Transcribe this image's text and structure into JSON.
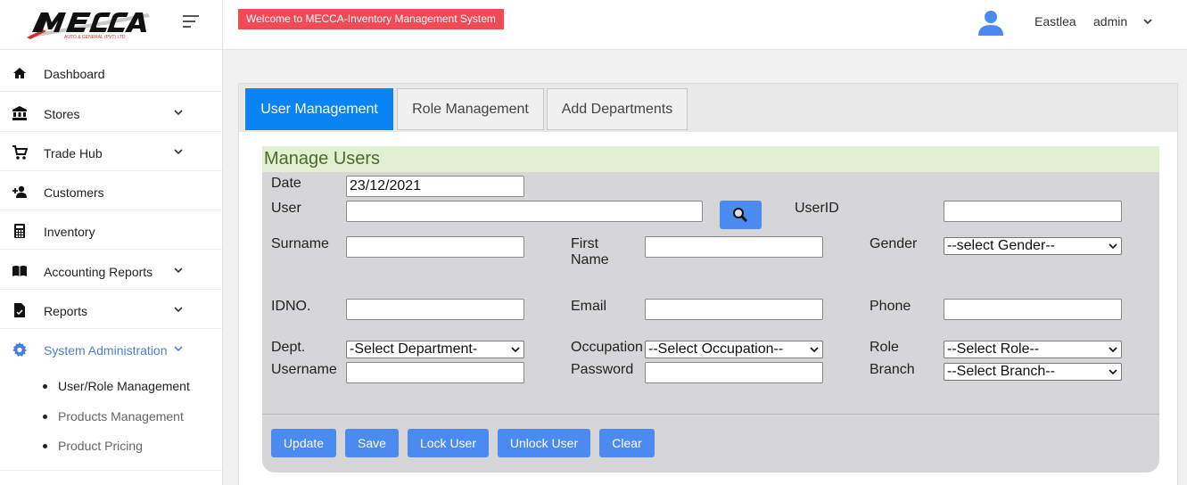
{
  "brand": {
    "logo_text": "MECCA",
    "logo_subtext": "AUTO & GENERAL (PVT) LTD",
    "accent": "#4a7fd4",
    "welcome_bg": "#f04a55",
    "primary_button": "#4b8af0",
    "active_tab": "#0a84f4"
  },
  "header": {
    "welcome": "Welcome to MECCA-Inventory Management System",
    "location": "Eastlea",
    "username": "admin"
  },
  "sidebar": {
    "items": [
      {
        "label": "Dashboard",
        "icon": "home-icon",
        "has_children": false
      },
      {
        "label": "Stores",
        "icon": "bank-icon",
        "has_children": true
      },
      {
        "label": "Trade Hub",
        "icon": "cart-icon",
        "has_children": true
      },
      {
        "label": "Customers",
        "icon": "person-add-icon",
        "has_children": false
      },
      {
        "label": "Inventory",
        "icon": "calculator-icon",
        "has_children": false
      },
      {
        "label": "Accounting Reports",
        "icon": "book-icon",
        "has_children": true
      },
      {
        "label": "Reports",
        "icon": "document-icon",
        "has_children": true
      },
      {
        "label": "System Administration",
        "icon": "gear-icon",
        "has_children": true,
        "active": true
      }
    ],
    "sub_items": [
      {
        "label": "User/Role Management",
        "current": true
      },
      {
        "label": "Products Management"
      },
      {
        "label": "Product Pricing"
      }
    ]
  },
  "tabs": [
    {
      "label": "User Management",
      "active": true
    },
    {
      "label": "Role Management"
    },
    {
      "label": "Add Departments"
    }
  ],
  "form": {
    "title": "Manage Users",
    "date_label": "Date",
    "date_value": "23/12/2021",
    "user_label": "User",
    "user_value": "",
    "userid_label": "UserID",
    "userid_value": "",
    "surname_label": "Surname",
    "firstname_label": "First Name",
    "gender_label": "Gender",
    "gender_selected": "--select Gender--",
    "idno_label": "IDNO.",
    "email_label": "Email",
    "phone_label": "Phone",
    "dept_label": "Dept.",
    "dept_selected": "-Select Department-",
    "occupation_label": "Occupation",
    "occupation_selected": "--Select Occupation--",
    "role_label": "Role",
    "role_selected": "--Select Role--",
    "username_label": "Username",
    "password_label": "Password",
    "branch_label": "Branch",
    "branch_selected": "--Select Branch--"
  },
  "actions": {
    "update": "Update",
    "save": "Save",
    "lock": "Lock User",
    "unlock": "Unlock User",
    "clear": "Clear"
  }
}
